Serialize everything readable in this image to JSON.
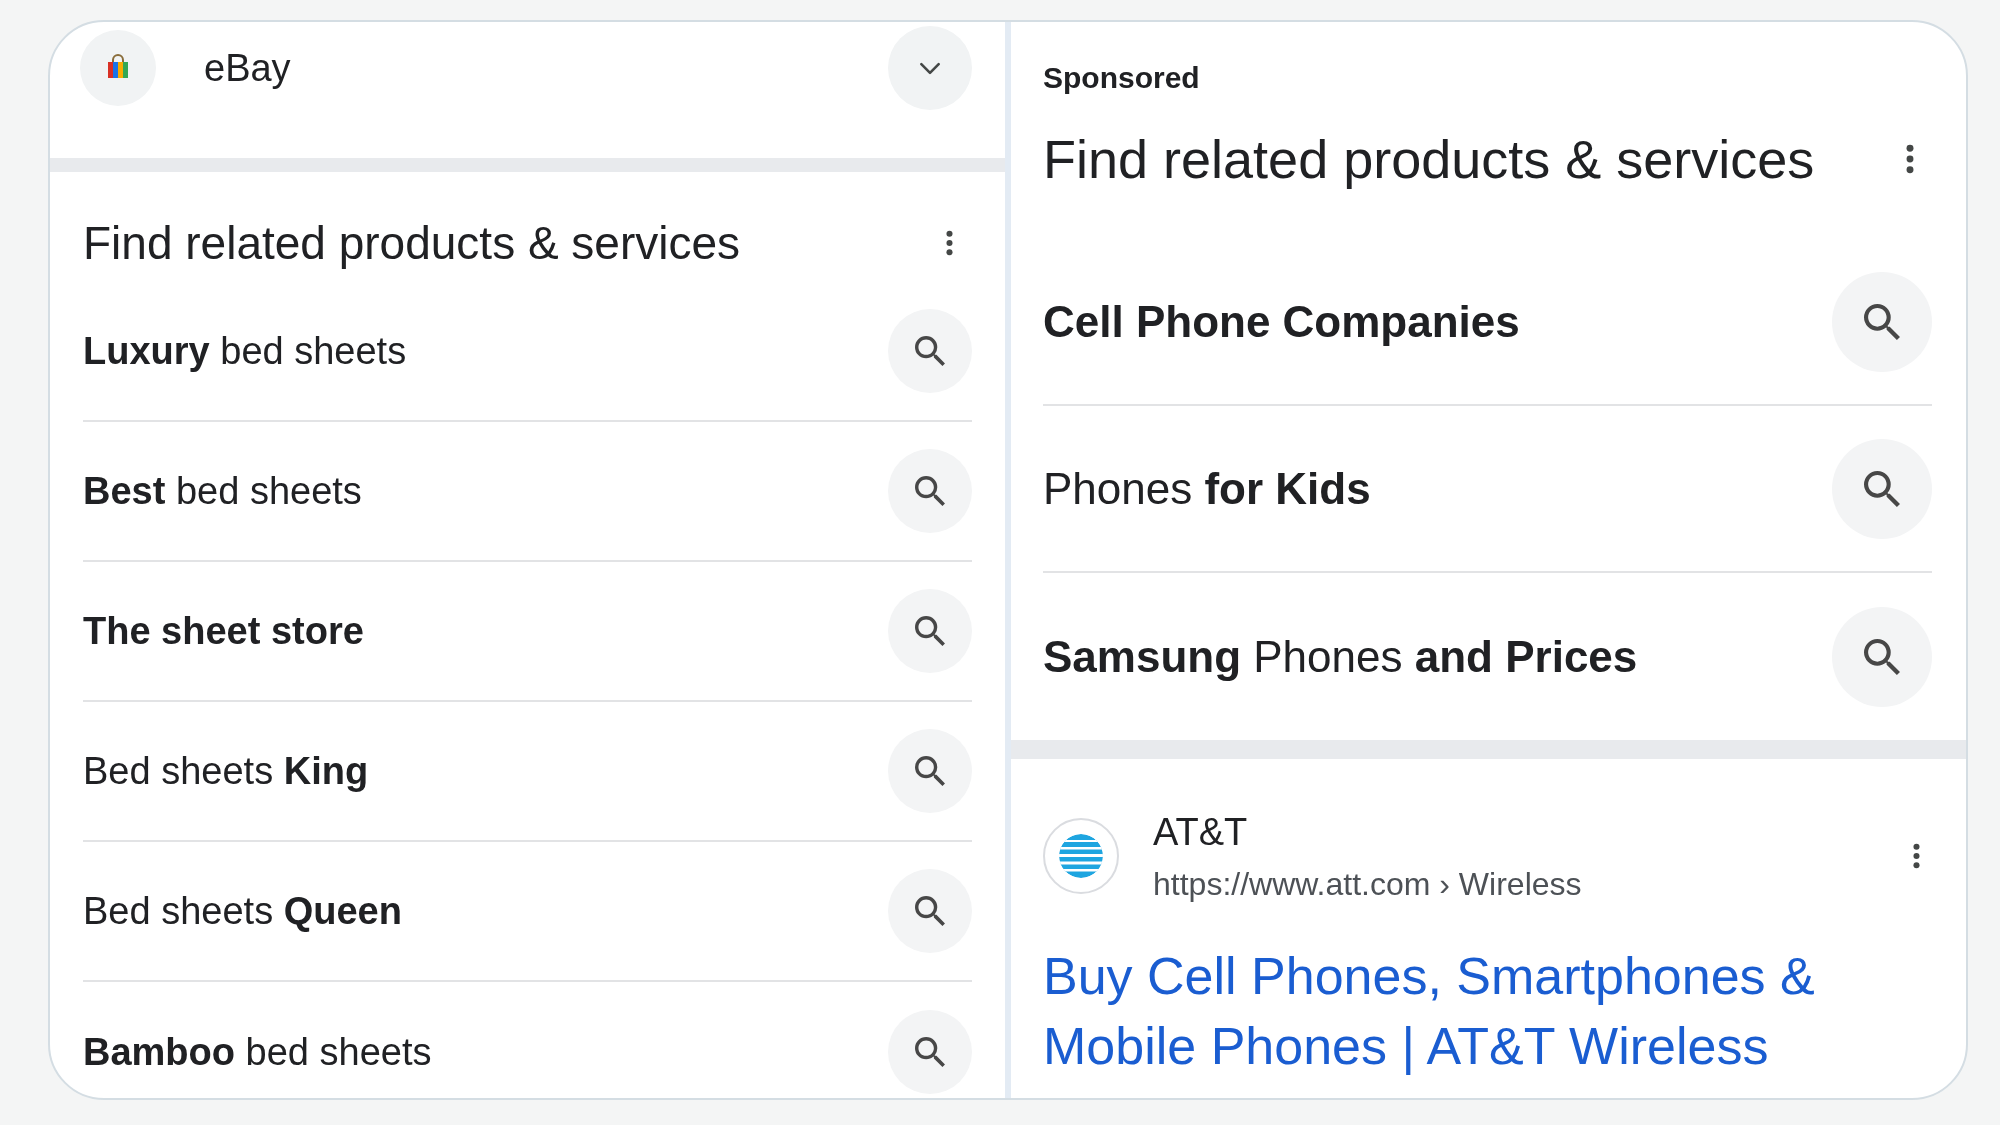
{
  "source_panel": {
    "source": {
      "name": "eBay"
    },
    "related_searches": {
      "title": "Find related products & services",
      "items": [
        {
          "text": "**Luxury** bed sheets"
        },
        {
          "text": "**Best** bed sheets"
        },
        {
          "text": "**The sheet store**"
        },
        {
          "text": "Bed sheets **King**"
        },
        {
          "text": "Bed sheets **Queen**"
        },
        {
          "text": "**Bamboo** bed sheets"
        }
      ]
    }
  },
  "sponsored_panel": {
    "label": "Sponsored",
    "related_searches": {
      "title": "Find related products & services",
      "items": [
        {
          "text": "**Cell Phone Companies**"
        },
        {
          "text": "Phones **for Kids**"
        },
        {
          "text": "**Samsung** Phones **and Prices**"
        }
      ]
    },
    "ad": {
      "advertiser": "AT&T",
      "url": "https://www.att.com › Wireless",
      "headline": "Buy Cell Phones, Smartphones & Mobile Phones | AT&T Wireless"
    }
  }
}
